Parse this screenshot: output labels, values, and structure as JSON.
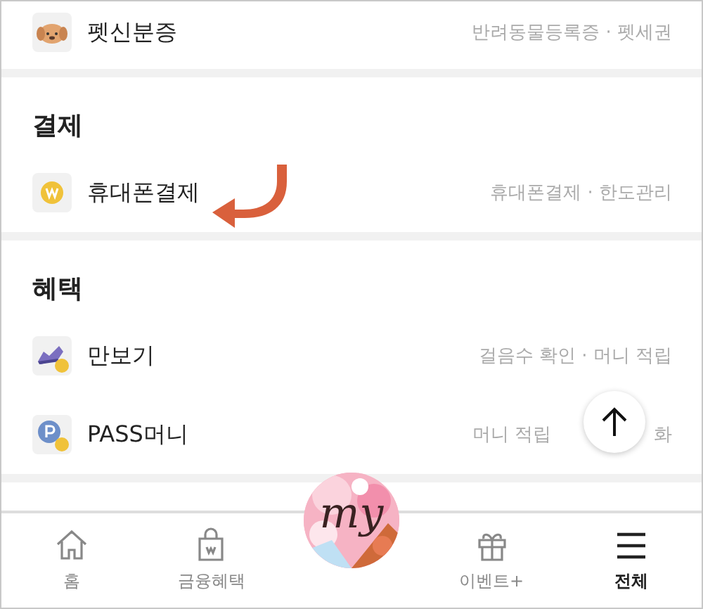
{
  "sections": [
    {
      "rows": [
        {
          "label": "펫신분증",
          "detail": "반려동물등록증 · 펫세권"
        }
      ]
    },
    {
      "title": "결제",
      "rows": [
        {
          "label": "휴대폰결제",
          "detail": "휴대폰결제 · 한도관리",
          "pointed": true
        }
      ]
    },
    {
      "title": "혜택",
      "rows": [
        {
          "label": "만보기",
          "detail": "걸음수 확인 · 머니 적립"
        },
        {
          "label": "PASS머니",
          "detail": "머니 적립",
          "detail_end": "화"
        }
      ]
    }
  ],
  "nav": {
    "items": [
      {
        "kind": "tab",
        "label": "홈",
        "selected": false
      },
      {
        "kind": "tab",
        "label": "금융혜택",
        "selected": false
      },
      {
        "kind": "logo",
        "label": "my"
      },
      {
        "kind": "tab",
        "label": "이벤트+",
        "selected": false
      },
      {
        "kind": "tab",
        "label": "전체",
        "selected": true
      }
    ]
  }
}
